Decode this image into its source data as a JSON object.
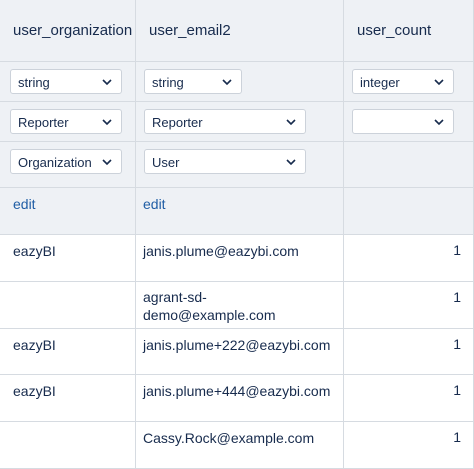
{
  "columns": [
    {
      "header": "user_organization",
      "type": "string",
      "role": "Reporter",
      "dimension": "Organization",
      "edit": "edit"
    },
    {
      "header": "user_email2",
      "type": "string",
      "role": "Reporter",
      "dimension": "User",
      "edit": "edit"
    },
    {
      "header": "user_count",
      "type": "integer",
      "role": "",
      "dimension": "",
      "edit": ""
    }
  ],
  "rows": [
    {
      "organization": "eazyBI",
      "email": "janis.plume@eazybi.com",
      "count": "1"
    },
    {
      "organization": "",
      "email": "agrant-sd-\ndemo@example.com",
      "count": "1"
    },
    {
      "organization": "eazyBI",
      "email": "janis.plume+222@eazybi.com",
      "count": "1"
    },
    {
      "organization": "eazyBI",
      "email": "janis.plume+444@eazybi.com",
      "count": "1"
    },
    {
      "organization": "",
      "email": "Cassy.Rock@example.com",
      "count": "1"
    }
  ]
}
